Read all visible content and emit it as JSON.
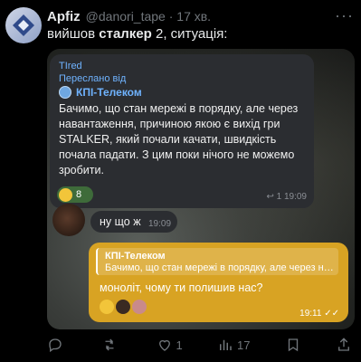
{
  "post": {
    "author_name": "Apfiz",
    "handle_time": "@danori_tape · 17 хв.",
    "more_glyph": "···",
    "text_before": "вийшов ",
    "text_bold": "сталкер",
    "text_after": " 2, ситуація:"
  },
  "chat": {
    "incoming": {
      "from": "TIred",
      "forwarded_label": "Переслано від",
      "source": "КПІ-Телеком",
      "text": "Бачимо, що стан мережі в порядку, але через навантаження, причиною якою є вихід гри STALKER, який почали качати, швидкість почала падати. З цим поки нічого не можемо зробити.",
      "reaction_count": "8",
      "meta": "↩ 1  19:09"
    },
    "short": {
      "text": "ну що ж",
      "time": "19:09"
    },
    "outgoing": {
      "quote_name": "КПІ-Телеком",
      "quote_text": "Бачимо, що стан мережі в порядку, але через н…",
      "text": "моноліт, чому ти полишив нас?",
      "time": "19:11"
    }
  },
  "actions": {
    "reply_count": "",
    "retweet_count": "",
    "like_count": "1",
    "views_count": "17"
  },
  "colors": {
    "bubble_in": "#2b2d31",
    "bubble_out": "#d8a323",
    "link_blue": "#6fb3ff",
    "muted": "#71767b"
  }
}
